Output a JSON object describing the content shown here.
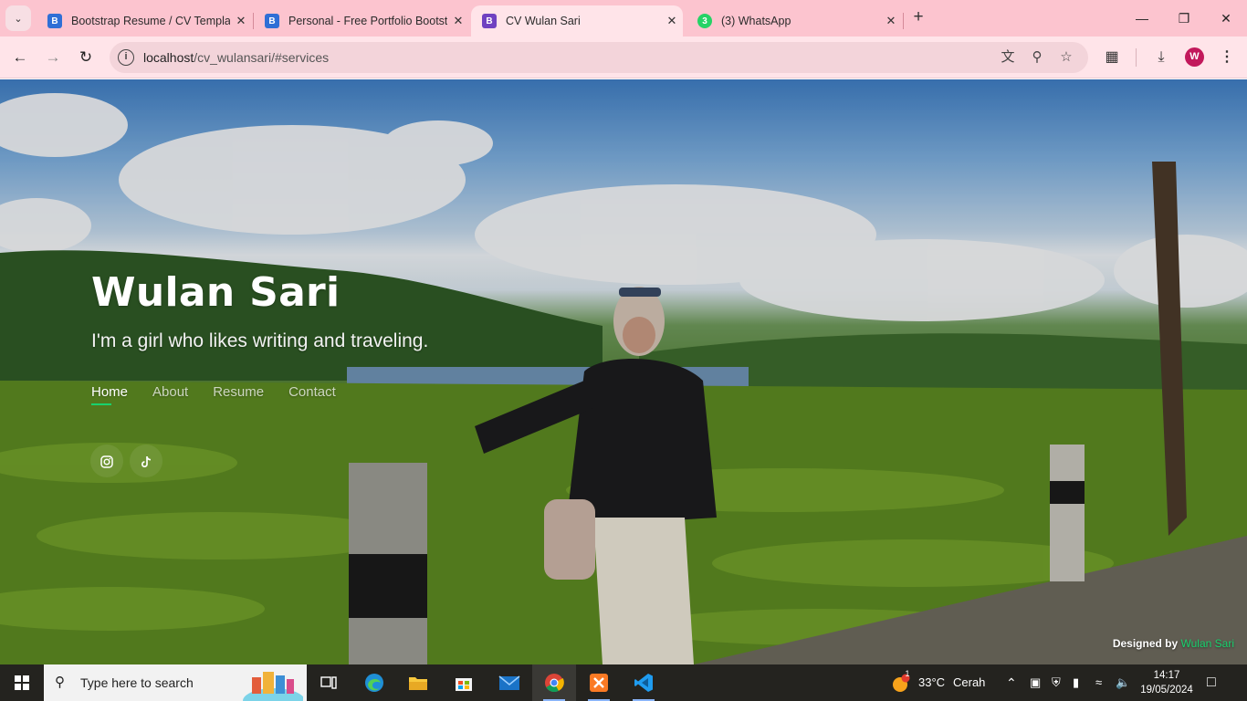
{
  "browser": {
    "tabs": [
      {
        "title": "Bootstrap Resume / CV Templat",
        "favicon": "bootstrapmade-icon",
        "active": false
      },
      {
        "title": "Personal - Free Portfolio Bootst",
        "favicon": "bootstrapmade-icon",
        "active": false
      },
      {
        "title": "CV Wulan Sari",
        "favicon": "bootstrap-b-icon",
        "active": true
      },
      {
        "title": "(3) WhatsApp",
        "favicon": "whatsapp-icon",
        "active": false
      }
    ],
    "url_host": "localhost",
    "url_path": "/cv_wulansari/#services",
    "profile_initial": "W"
  },
  "page": {
    "name": "Wulan Sari",
    "tagline": "I'm a girl who likes writing and traveling.",
    "nav": [
      "Home",
      "About",
      "Resume",
      "Contact"
    ],
    "active_nav": "Home",
    "social": [
      "instagram-icon",
      "tiktok-icon"
    ],
    "credits_prefix": "Designed by",
    "credits_link": "Wulan Sari",
    "accent": "#18d26e"
  },
  "taskbar": {
    "search_placeholder": "Type here to search",
    "weather_temp": "33°C",
    "weather_desc": "Cerah",
    "weather_badge": "1",
    "time": "14:17",
    "date": "19/05/2024"
  }
}
